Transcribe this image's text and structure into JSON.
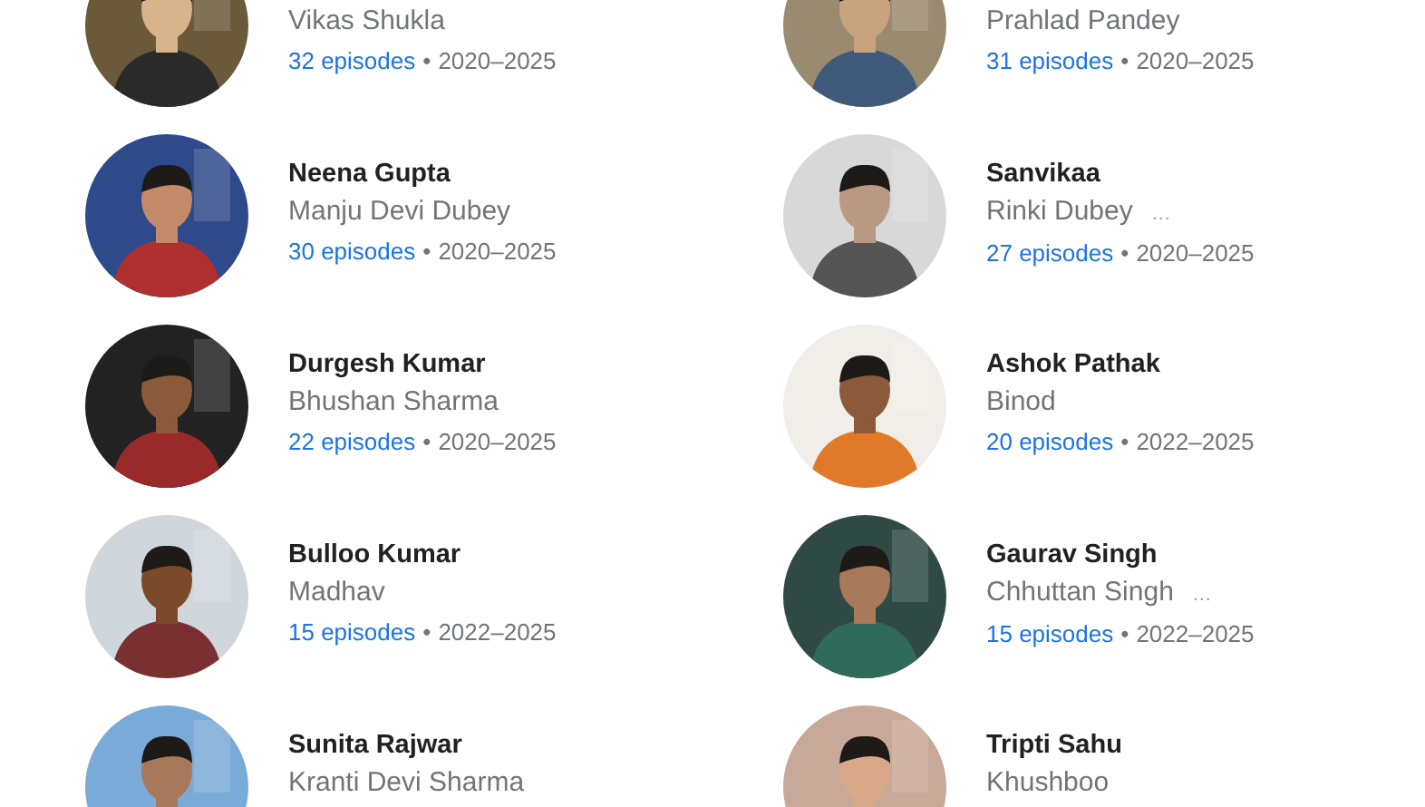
{
  "cast": [
    {
      "role": "Vikas Shukla",
      "episodes": "32 episodes",
      "separator": "•",
      "years": "2020–2025"
    },
    {
      "role": "Prahlad Pandey",
      "episodes": "31 episodes",
      "separator": "•",
      "years": "2020–2025"
    },
    {
      "name": "Neena Gupta",
      "role": "Manju Devi Dubey",
      "episodes": "30 episodes",
      "separator": "•",
      "years": "2020–2025"
    },
    {
      "name": "Sanvikaa",
      "role": "Rinki Dubey",
      "more": "…",
      "episodes": "27 episodes",
      "separator": "•",
      "years": "2020–2025"
    },
    {
      "name": "Durgesh Kumar",
      "role": "Bhushan Sharma",
      "episodes": "22 episodes",
      "separator": "•",
      "years": "2020–2025"
    },
    {
      "name": "Ashok Pathak",
      "role": "Binod",
      "episodes": "20 episodes",
      "separator": "•",
      "years": "2022–2025"
    },
    {
      "name": "Bulloo Kumar",
      "role": "Madhav",
      "episodes": "15 episodes",
      "separator": "•",
      "years": "2022–2025"
    },
    {
      "name": "Gaurav Singh",
      "role": "Chhuttan Singh",
      "more": "…",
      "episodes": "15 episodes",
      "separator": "•",
      "years": "2022–2025"
    },
    {
      "name": "Sunita Rajwar",
      "role": "Kranti Devi Sharma"
    },
    {
      "name": "Tripti Sahu",
      "role": "Khushboo"
    }
  ]
}
